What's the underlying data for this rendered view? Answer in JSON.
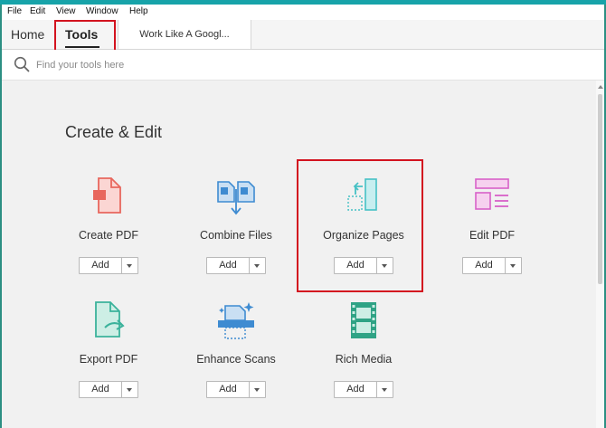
{
  "menu": [
    "File",
    "Edit",
    "View",
    "Window",
    "Help"
  ],
  "tabs": {
    "home": "Home",
    "tools": "Tools",
    "document": "Work Like A Googl..."
  },
  "search": {
    "placeholder": "Find your tools here"
  },
  "section": {
    "title": "Create & Edit"
  },
  "tools": [
    {
      "label": "Create PDF",
      "icon": "create-pdf-icon",
      "add": "Add"
    },
    {
      "label": "Combine Files",
      "icon": "combine-files-icon",
      "add": "Add"
    },
    {
      "label": "Organize Pages",
      "icon": "organize-pages-icon",
      "add": "Add"
    },
    {
      "label": "Edit PDF",
      "icon": "edit-pdf-icon",
      "add": "Add"
    },
    {
      "label": "Export PDF",
      "icon": "export-pdf-icon",
      "add": "Add"
    },
    {
      "label": "Enhance Scans",
      "icon": "enhance-scans-icon",
      "add": "Add"
    },
    {
      "label": "Rich Media",
      "icon": "rich-media-icon",
      "add": "Add"
    }
  ],
  "colors": {
    "accent": "#17a3a9",
    "highlight_border": "#d3131f",
    "create_pdf": "#e8675d",
    "combine_files": "#3e8bd1",
    "organize_pages": "#45c1c5",
    "edit_pdf": "#d861c9",
    "export_pdf": "#3bb29b",
    "enhance_scans": "#3e8bd1",
    "rich_media": "#2fa385"
  }
}
